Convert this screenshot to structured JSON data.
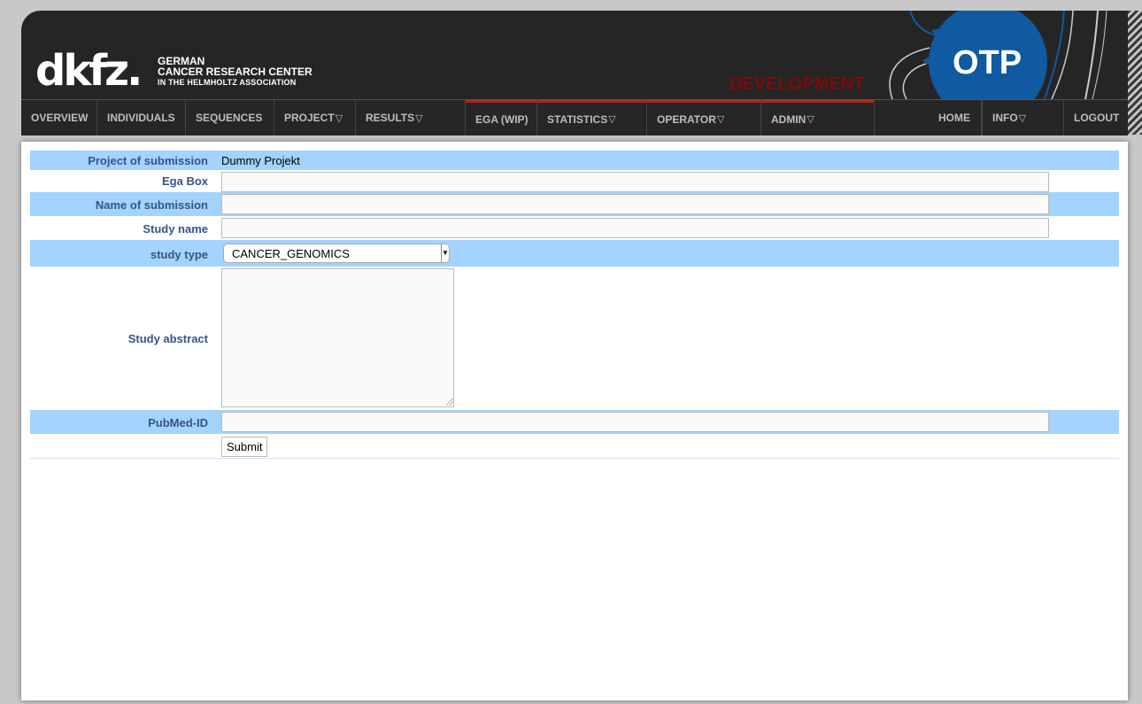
{
  "header": {
    "logo_mark": "dkfz.",
    "logo_line1": "GERMAN",
    "logo_line2": "CANCER RESEARCH CENTER",
    "logo_line3": "IN THE HELMHOLTZ ASSOCIATION",
    "environment_label": "DEVELOPMENT",
    "app_logo": "OTP"
  },
  "nav": {
    "overview": "OVERVIEW",
    "individuals": "INDIVIDUALS",
    "sequences": "SEQUENCES",
    "project": "PROJECT",
    "results": "RESULTS",
    "ega": "EGA (WIP)",
    "statistics": "STATISTICS",
    "operator": "OPERATOR",
    "admin": "ADMIN",
    "home": "HOME",
    "info": "INFO",
    "logout": "LOGOUT",
    "dropdown_glyph": "▽"
  },
  "form": {
    "project_label": "Project of submission",
    "project_value": "Dummy Projekt",
    "ega_box_label": "Ega Box",
    "ega_box_value": "",
    "submission_name_label": "Name of submission",
    "submission_name_value": "",
    "study_name_label": "Study name",
    "study_name_value": "",
    "study_type_label": "study type",
    "study_type_selected": "CANCER_GENOMICS",
    "study_abstract_label": "Study abstract",
    "study_abstract_value": "",
    "pubmed_label": "PubMed-ID",
    "pubmed_value": "",
    "submit_label": "Submit"
  },
  "colors": {
    "header_bg": "#252525",
    "row_highlight": "#a3d3ff",
    "label_text": "#35538a",
    "environment_text": "#7a0c0c",
    "nav_accent": "#a52a1a",
    "otp_blue": "#0f5aa0"
  }
}
